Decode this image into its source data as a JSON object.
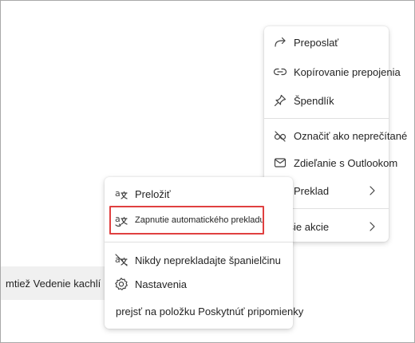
{
  "background": {
    "message_text": "mtiež Vedenie kachlí",
    "more_icon": "more-horizontal-icon",
    "accent_color": "#5b5fc7"
  },
  "main_menu": {
    "items": [
      {
        "label": "Preposlať",
        "icon": "forward-icon"
      },
      {
        "label": "Kopírovanie prepojenia",
        "icon": "link-icon"
      },
      {
        "label": "Špendlík",
        "icon": "pin-icon"
      },
      {
        "label": "Označiť ako neprečítané",
        "icon": "eye-off-icon"
      },
      {
        "label": "Zdieľanie s Outlookom",
        "icon": "mail-icon"
      },
      {
        "label": "Preklad",
        "icon": "translate-icon",
        "has_submenu": true
      },
      {
        "label": "Ďalšie akcie",
        "has_submenu": true
      }
    ]
  },
  "sub_menu": {
    "items": [
      {
        "label": "Preložiť",
        "icon": "translate-icon"
      },
      {
        "label": "Zapnutie automatického prekladu",
        "icon": "auto-translate-icon",
        "highlighted": true
      },
      {
        "label": "Nikdy neprekladajte španielčinu",
        "icon": "translate-off-icon"
      },
      {
        "label": "Nastavenia",
        "icon": "gear-icon"
      },
      {
        "label": "prejsť na položku Poskytnúť pripomienky"
      }
    ],
    "highlight_color": "#e04040"
  }
}
